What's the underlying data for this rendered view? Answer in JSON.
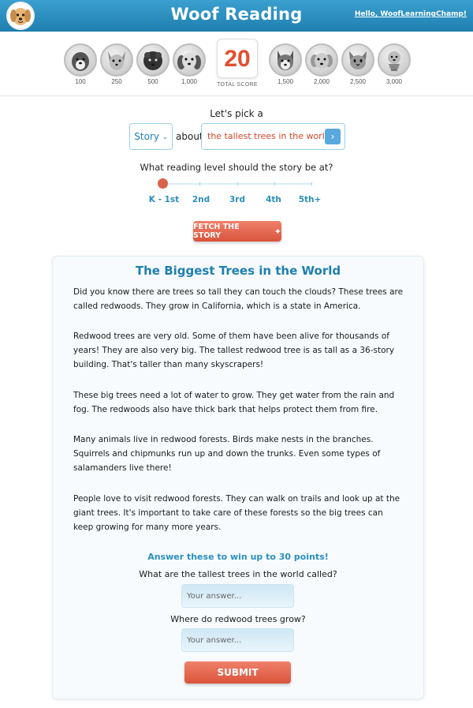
{
  "header": {
    "logo_icon": "dog-logo-icon",
    "title": "Woof Reading",
    "greeting": "Hello, WoofLearningChamp!"
  },
  "badges": [
    {
      "label": "100",
      "icon": "bernese-dog-icon"
    },
    {
      "label": "250",
      "icon": "chihuahua-dog-icon"
    },
    {
      "label": "500",
      "icon": "poodle-dog-icon"
    },
    {
      "label": "1,000",
      "icon": "cavalier-dog-icon"
    },
    {
      "label": "1,500",
      "icon": "husky-dog-icon"
    },
    {
      "label": "2,000",
      "icon": "golden-dog-icon"
    },
    {
      "label": "2,500",
      "icon": "cat-icon"
    },
    {
      "label": "3,000",
      "icon": "trophy-dog-icon"
    }
  ],
  "score": {
    "value": "20",
    "label": "TOTAL SCORE"
  },
  "picker": {
    "prompt": "Let's pick a",
    "type_value": "Story",
    "about": "about",
    "topic_value": "the tallest trees in the world",
    "level_prompt": "What reading level should the story be at?",
    "levels": [
      "K - 1st",
      "2nd",
      "3rd",
      "4th",
      "5th+"
    ],
    "selected_level_index": 0,
    "fetch_label": "FETCH THE STORY"
  },
  "story": {
    "title": "The Biggest Trees in the World",
    "paragraphs": [
      "Did you know there are trees so tall they can touch the clouds? These trees are called redwoods. They grow in California, which is a state in America.",
      "Redwood trees are very old. Some of them have been alive for thousands of years! They are also very big. The tallest redwood tree is as tall as a 36-story building. That's taller than many skyscrapers!",
      "These big trees need a lot of water to grow. They get water from the rain and fog. The redwoods also have thick bark that helps protect them from fire.",
      "Many animals live in redwood forests. Birds make nests in the branches. Squirrels and chipmunks run up and down the trunks. Even some types of salamanders live there!",
      "People love to visit redwood forests. They can walk on trails and look up at the giant trees. It's important to take care of these forests so the big trees can keep growing for many more years."
    ]
  },
  "quiz": {
    "heading": "Answer these to win up to 30 points!",
    "questions": [
      {
        "text": "What are the tallest trees in the world called?",
        "placeholder": "Your answer..."
      },
      {
        "text": "Where do redwood trees grow?",
        "placeholder": "Your answer..."
      }
    ],
    "submit_label": "SUBMIT"
  },
  "colors": {
    "header": "#2a8fc0",
    "accent": "#e0502f",
    "link": "#2a8fc0"
  }
}
